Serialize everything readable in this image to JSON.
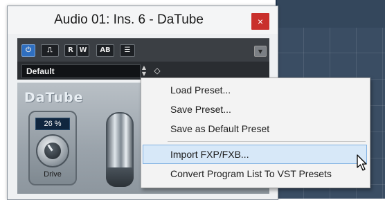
{
  "window": {
    "title": "Audio 01: Ins. 6 - DaTube",
    "close_label": "×"
  },
  "toolbar": {
    "power_icon": "⏻",
    "bypass_label": "⎍",
    "read_label": "R",
    "write_label": "W",
    "ab_label": "AB",
    "menu_label": "☰",
    "dropdown_icon": "▼"
  },
  "preset": {
    "name": "Default",
    "stepper_up": "▲",
    "stepper_down": "▼",
    "options_icon": "◇"
  },
  "plugin": {
    "logo": "DaTube",
    "drive_value": "26 %",
    "drive_label": "Drive"
  },
  "context_menu": {
    "items": [
      {
        "label": "Load Preset..."
      },
      {
        "label": "Save Preset..."
      },
      {
        "label": "Save as Default Preset"
      },
      {
        "label": "Import FXP/FXB..."
      },
      {
        "label": "Convert Program List To VST Presets"
      }
    ],
    "highlighted": "Import FXP/FXB..."
  },
  "colors": {
    "accent": "#2f6fc0",
    "close_button": "#c9302c",
    "highlight": "#d7e8f8"
  }
}
